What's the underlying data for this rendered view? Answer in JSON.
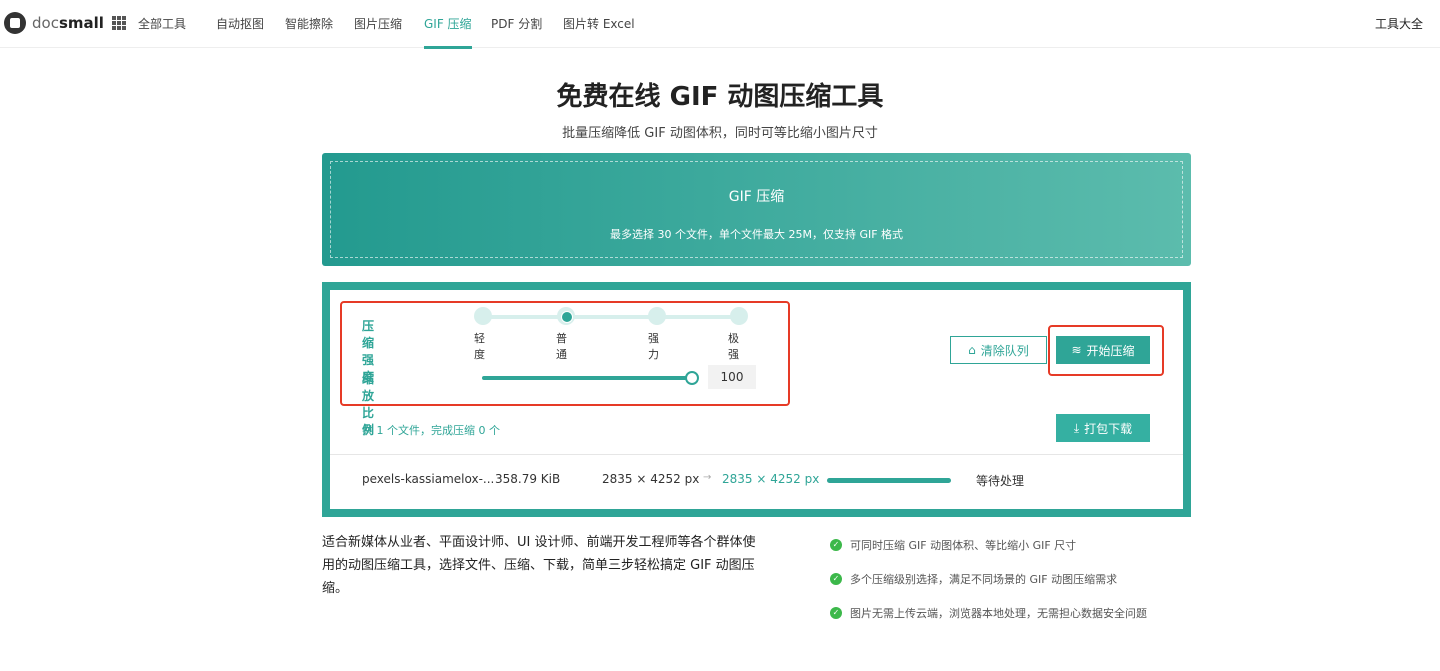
{
  "nav": {
    "logo_light": "doc",
    "logo_bold": "small",
    "all_tools": "全部工具",
    "items": [
      "自动抠图",
      "智能擦除",
      "图片压缩",
      "GIF 压缩",
      "PDF 分割",
      "图片转 Excel"
    ],
    "active": "GIF 压缩",
    "right": "工具大全"
  },
  "title": "免费在线 GIF 动图压缩工具",
  "subtitle": "批量压缩降低 GIF 动图体积，同时可等比缩小图片尺寸",
  "upload": {
    "title": "GIF 压缩",
    "desc": "最多选择 30 个文件，单个文件最大 25M，仅支持 GIF 格式"
  },
  "settings": {
    "strength_label": "压缩强度",
    "levels": [
      "轻度",
      "普通",
      "强力",
      "极强"
    ],
    "selected_level": "普通",
    "scale_label": "缩放比例",
    "scale_value": "100"
  },
  "buttons": {
    "clear": "清除队列",
    "start": "开始压缩",
    "download": "打包下载"
  },
  "count": "共 1 个文件，完成压缩 0 个",
  "file": {
    "name": "pexels-kassiamelox-...",
    "size": "358.79 KiB",
    "orig_dim": "2835 × 4252 px",
    "arrow": "→",
    "new_dim": "2835 × 4252 px",
    "progress_percent": 100,
    "status": "等待处理"
  },
  "description": "适合新媒体从业者、平面设计师、UI 设计师、前端开发工程师等各个群体使用的动图压缩工具，选择文件、压缩、下载，简单三步轻松搞定 GIF 动图压缩。",
  "features": [
    "可同时压缩 GIF 动图体积、等比缩小 GIF 尺寸",
    "多个压缩级别选择，满足不同场景的 GIF 动图压缩需求",
    "图片无需上传云端，浏览器本地处理，无需担心数据安全问题"
  ],
  "colors": {
    "accent": "#2fa597",
    "highlight": "#e63a26",
    "check": "#3cb84a"
  }
}
